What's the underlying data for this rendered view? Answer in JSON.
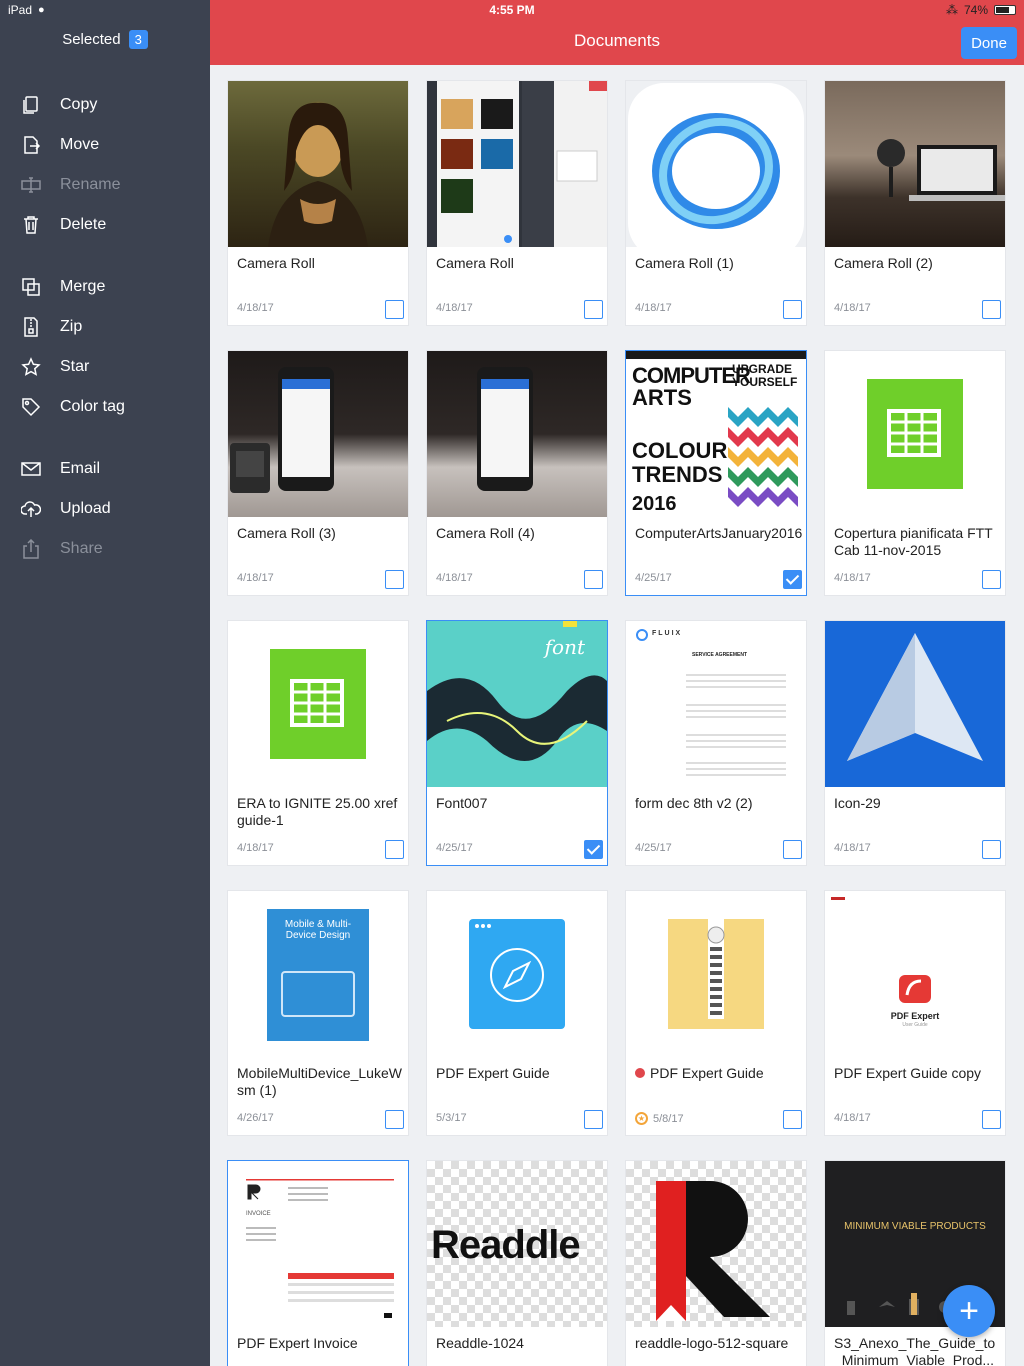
{
  "status": {
    "device": "iPad",
    "time": "4:55 PM",
    "battery": "74%",
    "battery_level": 0.74
  },
  "sidebar": {
    "selected_label": "Selected",
    "selected_count": "3",
    "items": [
      {
        "label": "Copy",
        "icon": "copy-icon",
        "enabled": true
      },
      {
        "label": "Move",
        "icon": "move-icon",
        "enabled": true
      },
      {
        "label": "Rename",
        "icon": "rename-icon",
        "enabled": false
      },
      {
        "label": "Delete",
        "icon": "trash-icon",
        "enabled": true
      },
      {
        "label": "Merge",
        "icon": "merge-icon",
        "enabled": true
      },
      {
        "label": "Zip",
        "icon": "zip-icon",
        "enabled": true
      },
      {
        "label": "Star",
        "icon": "star-icon",
        "enabled": true
      },
      {
        "label": "Color tag",
        "icon": "tag-icon",
        "enabled": true
      },
      {
        "label": "Email",
        "icon": "mail-icon",
        "enabled": true
      },
      {
        "label": "Upload",
        "icon": "cloud-upload-icon",
        "enabled": true
      },
      {
        "label": "Share",
        "icon": "share-icon",
        "enabled": false
      }
    ]
  },
  "header": {
    "title": "Documents",
    "done_label": "Done",
    "accent": "#e0474c",
    "blue": "#3a8ef6"
  },
  "files": [
    {
      "name": "Camera Roll",
      "date": "4/18/17",
      "checked": false
    },
    {
      "name": "Camera Roll",
      "date": "4/18/17",
      "checked": false
    },
    {
      "name": "Camera Roll (1)",
      "date": "4/18/17",
      "checked": false
    },
    {
      "name": "Camera Roll (2)",
      "date": "4/18/17",
      "checked": false
    },
    {
      "name": "Camera Roll (3)",
      "date": "4/18/17",
      "checked": false
    },
    {
      "name": "Camera Roll (4)",
      "date": "4/18/17",
      "checked": false
    },
    {
      "name": "ComputerArtsJanuary2016",
      "date": "4/25/17",
      "checked": true
    },
    {
      "name": "Copertura pianificata FTTCab 11-nov-2015",
      "date": "4/18/17",
      "checked": false
    },
    {
      "name": "ERA to IGNITE 25.00 xref guide-1",
      "date": "4/18/17",
      "checked": false
    },
    {
      "name": "Font007",
      "date": "4/25/17",
      "checked": true
    },
    {
      "name": "form dec 8th v2 (2)",
      "date": "4/25/17",
      "checked": false
    },
    {
      "name": "Icon-29",
      "date": "4/18/17",
      "checked": false
    },
    {
      "name": "MobileMultiDevice_LukeWsm (1)",
      "date": "4/26/17",
      "checked": false
    },
    {
      "name": "PDF Expert Guide",
      "date": "5/3/17",
      "checked": false
    },
    {
      "name": "PDF Expert Guide",
      "date": "5/8/17",
      "checked": false,
      "red_tag": true,
      "starred": true
    },
    {
      "name": "PDF Expert Guide copy",
      "date": "4/18/17",
      "checked": false
    },
    {
      "name": "PDF Expert Invoice",
      "date": "",
      "checked": true
    },
    {
      "name": "Readdle-1024",
      "date": "",
      "checked": false
    },
    {
      "name": "readdle-logo-512-square",
      "date": "",
      "checked": false
    },
    {
      "name": "S3_Anexo_The_Guide_to_Minimum_Viable_Prod...",
      "date": "",
      "checked": false
    }
  ],
  "thumb_text": {
    "mag_title_1": "COMPUTER",
    "mag_title_2": "ARTS",
    "mag_side": "UPGRADE YOURSELF",
    "mag_trends": "COLOUR TRENDS",
    "mag_year": "2016",
    "font_word": "font",
    "book_title": "Mobile & Multi-Device Design",
    "pdfx_label": "PDF Expert",
    "pdfx_sub": "User Guide",
    "readdle_word": "Readdle",
    "mvp_title": "MINIMUM VIABLE PRODUCTS",
    "invoice_label": "INVOICE",
    "form_brand": "FLUIX",
    "form_title": "SERVICE AGREEMENT"
  },
  "fab_label": "+"
}
